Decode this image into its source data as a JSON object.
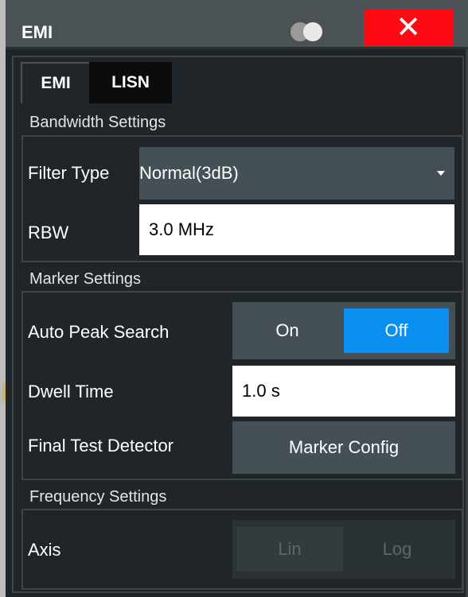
{
  "window": {
    "title": "EMI",
    "close_glyph": "✕"
  },
  "tabs": [
    {
      "label": "EMI",
      "active": true
    },
    {
      "label": "LISN",
      "active": false
    }
  ],
  "bandwidth": {
    "section_label": "Bandwidth Settings",
    "filter_type_label": "Filter Type",
    "filter_type_value": "Normal(3dB)",
    "rbw_label": "RBW",
    "rbw_value": "3.0 MHz"
  },
  "marker": {
    "section_label": "Marker Settings",
    "auto_peak_label": "Auto Peak Search",
    "auto_peak_on": "On",
    "auto_peak_off": "Off",
    "auto_peak_selected": "Off",
    "dwell_label": "Dwell Time",
    "dwell_value": "1.0 s",
    "detector_label": "Final Test Detector",
    "detector_button": "Marker Config"
  },
  "frequency": {
    "section_label": "Frequency Settings",
    "axis_label": "Axis",
    "axis_lin": "Lin",
    "axis_log": "Log",
    "axis_enabled": false
  },
  "colors": {
    "accent": "#0a8ef0",
    "close": "#ff0a14",
    "panel": "#1f2528",
    "control": "#445056"
  }
}
